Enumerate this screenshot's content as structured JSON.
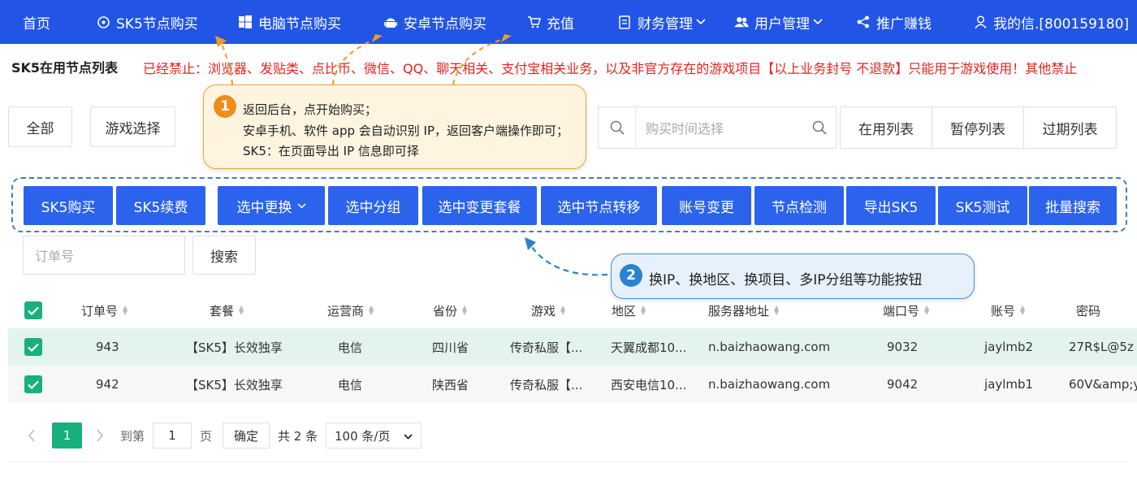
{
  "nav": {
    "home": "首页",
    "sk5_buy": "SK5节点购买",
    "pc_buy": "电脑节点购买",
    "android_buy": "安卓节点购买",
    "recharge": "充值",
    "finance": "财务管理",
    "user": "用户管理",
    "promo": "推广赚钱",
    "account": "我的信.[800159180]"
  },
  "notice": {
    "title": "SK5在用节点列表",
    "text": "已经禁止：浏览器、发贴类、点比币、微信、QQ、聊天相关、支付宝相关业务，以及非官方存在的游戏项目【以上业务封号 不退款】只能用于游戏使用！其他禁止"
  },
  "filters": {
    "all": "全部",
    "game_select": "游戏选择",
    "date_placeholder": "购买时间选择",
    "tab_active": "在用列表",
    "tab_paused": "暂停列表",
    "tab_expired": "过期列表"
  },
  "actions": {
    "buy": "SK5购买",
    "renew": "SK5续费",
    "change": "选中更换",
    "group": "选中分组",
    "change_plan": "选中变更套餐",
    "transfer": "选中节点转移",
    "account_change": "账号变更",
    "check": "节点检测",
    "export": "导出SK5",
    "test": "SK5测试",
    "batch_search": "批量搜索"
  },
  "search": {
    "order_placeholder": "订单号",
    "button": "搜索"
  },
  "table": {
    "headers": {
      "order": "订单号",
      "plan": "套餐",
      "carrier": "运营商",
      "province": "省份",
      "game": "游戏",
      "region": "地区",
      "server": "服务器地址",
      "port": "端口号",
      "account": "账号",
      "password": "密码"
    },
    "rows": [
      {
        "order": "943",
        "plan": "【SK5】长效独享",
        "carrier": "电信",
        "province": "四川省",
        "game": "传奇私服【...",
        "region": "天翼成都10...",
        "server": "n.baizhaowang.com",
        "port": "9032",
        "account": "jaylmb2",
        "password": "27R$L@5z"
      },
      {
        "order": "942",
        "plan": "【SK5】长效独享",
        "carrier": "电信",
        "province": "陕西省",
        "game": "传奇私服【...",
        "region": "西安电信10...",
        "server": "n.baizhaowang.com",
        "port": "9042",
        "account": "jaylmb1",
        "password": "60V&amp;y"
      }
    ]
  },
  "pagination": {
    "current": "1",
    "goto_label": "到第",
    "page_input": "1",
    "page_unit": "页",
    "confirm": "确定",
    "total": "共 2 条",
    "page_size": "100 条/页"
  },
  "callout1": {
    "number": "1",
    "line1": "返回后台，点开始购买；",
    "line2": "安卓手机、软件 app 会自动识别 IP，返回客户端操作即可；",
    "line3": "SK5：在页面导出 IP 信息即可择"
  },
  "callout2": {
    "number": "2",
    "text": "换IP、换地区、换项目、多IP分组等功能按钮"
  },
  "colors": {
    "nav_bg": "#2255e6",
    "button_blue": "#2b63ec",
    "accent_green": "#18b07e",
    "notice_red": "#e8231f",
    "callout_orange": "#f08c1a",
    "callout_blue": "#2a83d0"
  }
}
